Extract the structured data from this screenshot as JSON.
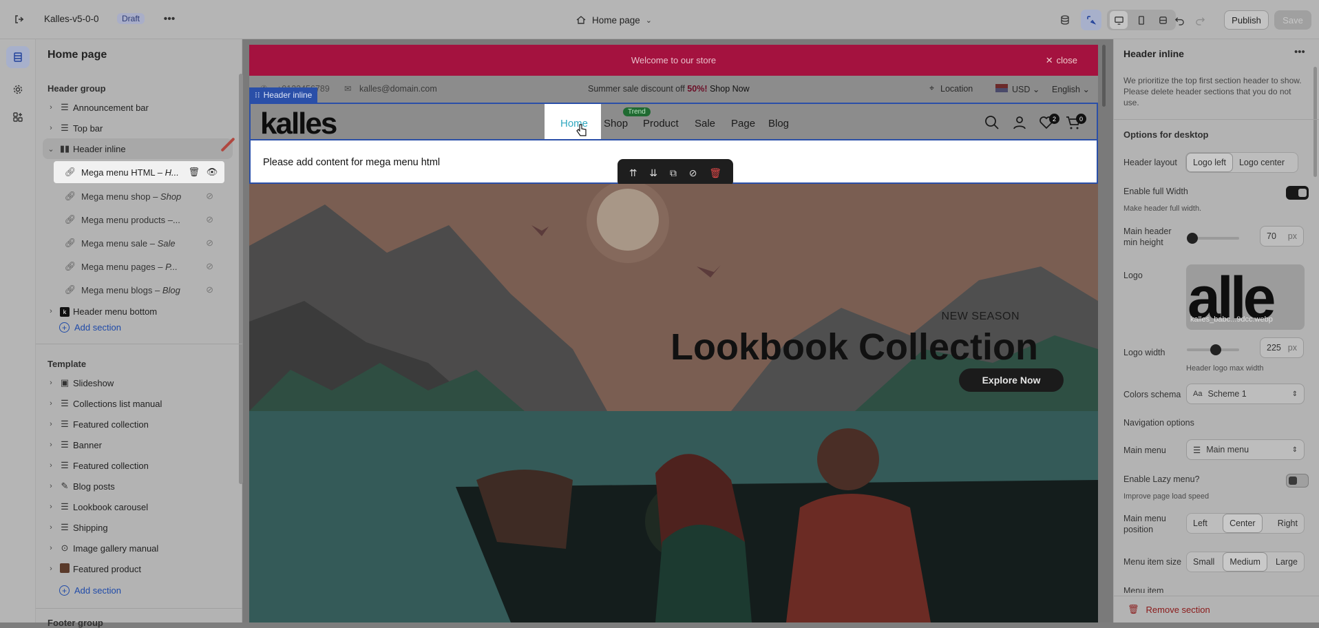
{
  "topbar": {
    "store_name": "Kalles-v5-0-0",
    "badge": "Draft",
    "page_selector": "Home page",
    "publish_label": "Publish",
    "save_label": "Save"
  },
  "left_panel": {
    "title": "Home page",
    "header_group_label": "Header group",
    "header_sections": [
      {
        "label": "Announcement bar"
      },
      {
        "label": "Top bar"
      },
      {
        "label": "Header inline"
      }
    ],
    "header_inline_blocks": [
      {
        "name": "Mega menu HTML",
        "suffix": "H..."
      },
      {
        "name": "Mega menu shop",
        "suffix": "Shop"
      },
      {
        "name": "Mega menu products",
        "suffix": "..."
      },
      {
        "name": "Mega menu sale",
        "suffix": "Sale"
      },
      {
        "name": "Mega menu pages",
        "suffix": "P..."
      },
      {
        "name": "Mega menu blogs",
        "suffix": "Blog"
      }
    ],
    "header_menu_bottom": "Header menu bottom",
    "add_section": "Add section",
    "template_label": "Template",
    "template_sections": [
      {
        "label": "Slideshow"
      },
      {
        "label": "Collections list manual"
      },
      {
        "label": "Featured collection"
      },
      {
        "label": "Banner"
      },
      {
        "label": "Featured collection"
      },
      {
        "label": "Blog posts"
      },
      {
        "label": "Lookbook carousel"
      },
      {
        "label": "Shipping"
      },
      {
        "label": "Image gallery manual"
      },
      {
        "label": "Featured product"
      }
    ],
    "add_section_2": "Add section",
    "footer_group_label": "Footer group"
  },
  "store": {
    "announcement": "Welcome to our store",
    "close": "close",
    "phone": "+0123456789",
    "email": "kalles@domain.com",
    "promo_text": "Summer sale discount off",
    "promo_pct": "50%!",
    "promo_link": "Shop Now",
    "location": "Location",
    "currency": "USD",
    "language": "English",
    "section_tag": "Header inline",
    "logo": "kalles",
    "nav": [
      "Home",
      "Shop",
      "Product",
      "Sale",
      "Page",
      "Blog"
    ],
    "trend_badge": "Trend",
    "wishlist_count": "2",
    "cart_count": "0",
    "mega_content": "Please add content for mega menu html",
    "hero_kicker": "NEW SEASON",
    "hero_title": "Lookbook Collection",
    "hero_cta": "Explore Now"
  },
  "right_panel": {
    "title": "Header inline",
    "info": "We prioritize the top first section header to show. Please delete header sections that you do not use.",
    "desktop_heading": "Options for desktop",
    "header_layout_label": "Header layout",
    "header_layout_options": [
      "Logo left",
      "Logo center"
    ],
    "full_width_label": "Enable full Width",
    "full_width_hint": "Make header full width.",
    "min_height_label": "Main header min height",
    "min_height_value": "70",
    "min_height_unit": "px",
    "min_height_fraction": 0.1,
    "logo_label": "Logo",
    "logo_filename": "kalles_babc...9dcc.webp",
    "logo_width_label": "Logo width",
    "logo_width_value": "225",
    "logo_width_unit": "px",
    "logo_width_fraction": 0.55,
    "logo_width_hint": "Header logo max width",
    "colors_label": "Colors schema",
    "colors_value": "Scheme 1",
    "nav_options_label": "Navigation options",
    "main_menu_label": "Main menu",
    "main_menu_value": "Main menu",
    "lazy_label": "Enable Lazy menu?",
    "lazy_hint": "Improve page load speed",
    "menu_position_label": "Main menu position",
    "menu_position_options": [
      "Left",
      "Center",
      "Right"
    ],
    "menu_item_size_label": "Menu item size",
    "menu_item_size_options": [
      "Small",
      "Medium",
      "Large"
    ],
    "menu_item_cut": "Menu item",
    "remove_section": "Remove section"
  },
  "colors": {
    "announcement_bg": "#a4123f",
    "accent_link": "#1f4aa8",
    "remove_red": "#8a1a1a"
  }
}
